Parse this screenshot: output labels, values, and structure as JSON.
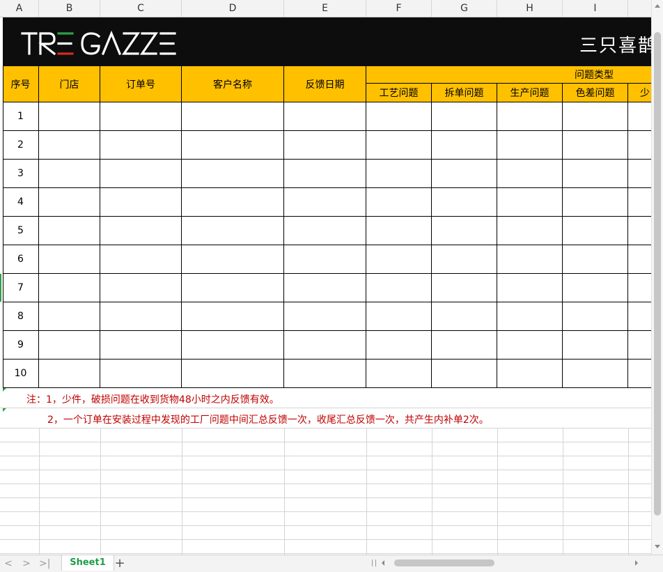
{
  "columns": [
    "A",
    "B",
    "C",
    "D",
    "E",
    "F",
    "G",
    "H",
    "I"
  ],
  "banner": {
    "brand_latin": "TRE GAZZE",
    "brand_cn": "三只喜鹊",
    "accent_colors": {
      "green": "#2e9e47",
      "white": "#ffffff",
      "red": "#d52b1e"
    }
  },
  "table": {
    "headers": {
      "seq": "序号",
      "store": "门店",
      "order_no": "订单号",
      "customer": "客户名称",
      "feedback_date": "反馈日期",
      "issue_type": "问题类型"
    },
    "issue_subheaders": [
      "工艺问题",
      "拆单问题",
      "生产问题",
      "色差问题",
      "少"
    ],
    "row_numbers": [
      "1",
      "2",
      "3",
      "4",
      "5",
      "6",
      "7",
      "8",
      "9",
      "10"
    ]
  },
  "notes": {
    "line1": "注：1，少件，破损问题在收到货物48小时之内反馈有效。",
    "line2": "2，一个订单在安装过程中发现的工厂问题中间汇总反馈一次，收尾汇总反馈一次，共产生内补单2次。"
  },
  "sheet_tabs": {
    "active": "Sheet1",
    "add": "+"
  },
  "nav": {
    "first": "<",
    "prev": ">",
    "last": ">|"
  }
}
